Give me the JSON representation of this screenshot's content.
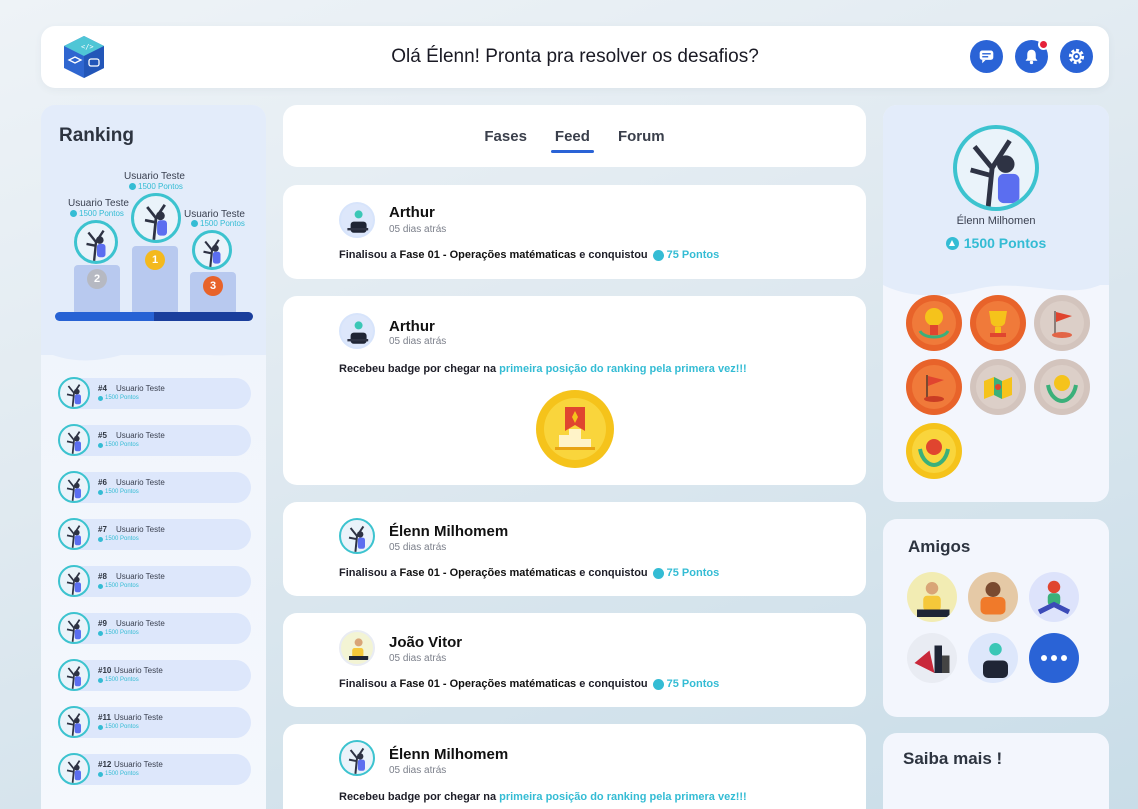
{
  "header": {
    "greeting": "Olá Élenn! Pronta pra resolver os desafios?"
  },
  "icons": {
    "chat": "chat-icon",
    "bell": "bell-icon",
    "settings": "gear-icon"
  },
  "colors": {
    "accent_blue": "#2a63d6",
    "accent_teal": "#34bcd4",
    "notification": "#e5213a"
  },
  "ranking": {
    "title": "Ranking",
    "podium": [
      {
        "place": "1",
        "name": "Usuario Teste",
        "points": "1500 Pontos"
      },
      {
        "place": "2",
        "name": "Usuario Teste",
        "points": "1500 Pontos"
      },
      {
        "place": "3",
        "name": "Usuario Teste",
        "points": "1500 Pontos"
      }
    ],
    "list": [
      {
        "rank": "#4",
        "name": "Usuario Teste",
        "points": "1500 Pontos"
      },
      {
        "rank": "#5",
        "name": "Usuario Teste",
        "points": "1500 Pontos"
      },
      {
        "rank": "#6",
        "name": "Usuario Teste",
        "points": "1500 Pontos"
      },
      {
        "rank": "#7",
        "name": "Usuario Teste",
        "points": "1500 Pontos"
      },
      {
        "rank": "#8",
        "name": "Usuario Teste",
        "points": "1500 Pontos"
      },
      {
        "rank": "#9",
        "name": "Usuario Teste",
        "points": "1500 Pontos"
      },
      {
        "rank": "#10",
        "name": "Usuario Teste",
        "points": "1500 Pontos"
      },
      {
        "rank": "#11",
        "name": "Usuario Teste",
        "points": "1500 Pontos"
      },
      {
        "rank": "#12",
        "name": "Usuario Teste",
        "points": "1500 Pontos"
      }
    ]
  },
  "tabs": [
    {
      "label": "Fases"
    },
    {
      "label": "Feed"
    },
    {
      "label": "Forum"
    }
  ],
  "feed": [
    {
      "author": "Arthur",
      "time": "05 dias atrás",
      "pre": "Finalisou a",
      "phase": "Fase 01 - Operações matématicas",
      "mid": "e conquistou",
      "points": "75 Pontos"
    },
    {
      "author": "Arthur",
      "time": "05 dias atrás",
      "pre": "Recebeu badge por chegar na",
      "highlight": "primeira posição do ranking pela primera vez!!!"
    },
    {
      "author": "Élenn Milhomem",
      "time": "05 dias atrás",
      "pre": "Finalisou a",
      "phase": "Fase 01 - Operações matématicas",
      "mid": "e conquistou",
      "points": "75 Pontos"
    },
    {
      "author": "João Vitor",
      "time": "05 dias atrás",
      "pre": "Finalisou a",
      "phase": "Fase 01 - Operações matématicas",
      "mid": "e conquistou",
      "points": "75 Pontos"
    },
    {
      "author": "Élenn Milhomem",
      "time": "05 dias atrás",
      "pre": "Recebeu badge por chegar na",
      "highlight": "primeira posição do ranking pela primera vez!!!"
    }
  ],
  "profile": {
    "name": "Élenn Milhomen",
    "points": "1500 Pontos"
  },
  "friends": {
    "title": "Amigos"
  },
  "saiba": {
    "title": "Saiba mais !"
  }
}
